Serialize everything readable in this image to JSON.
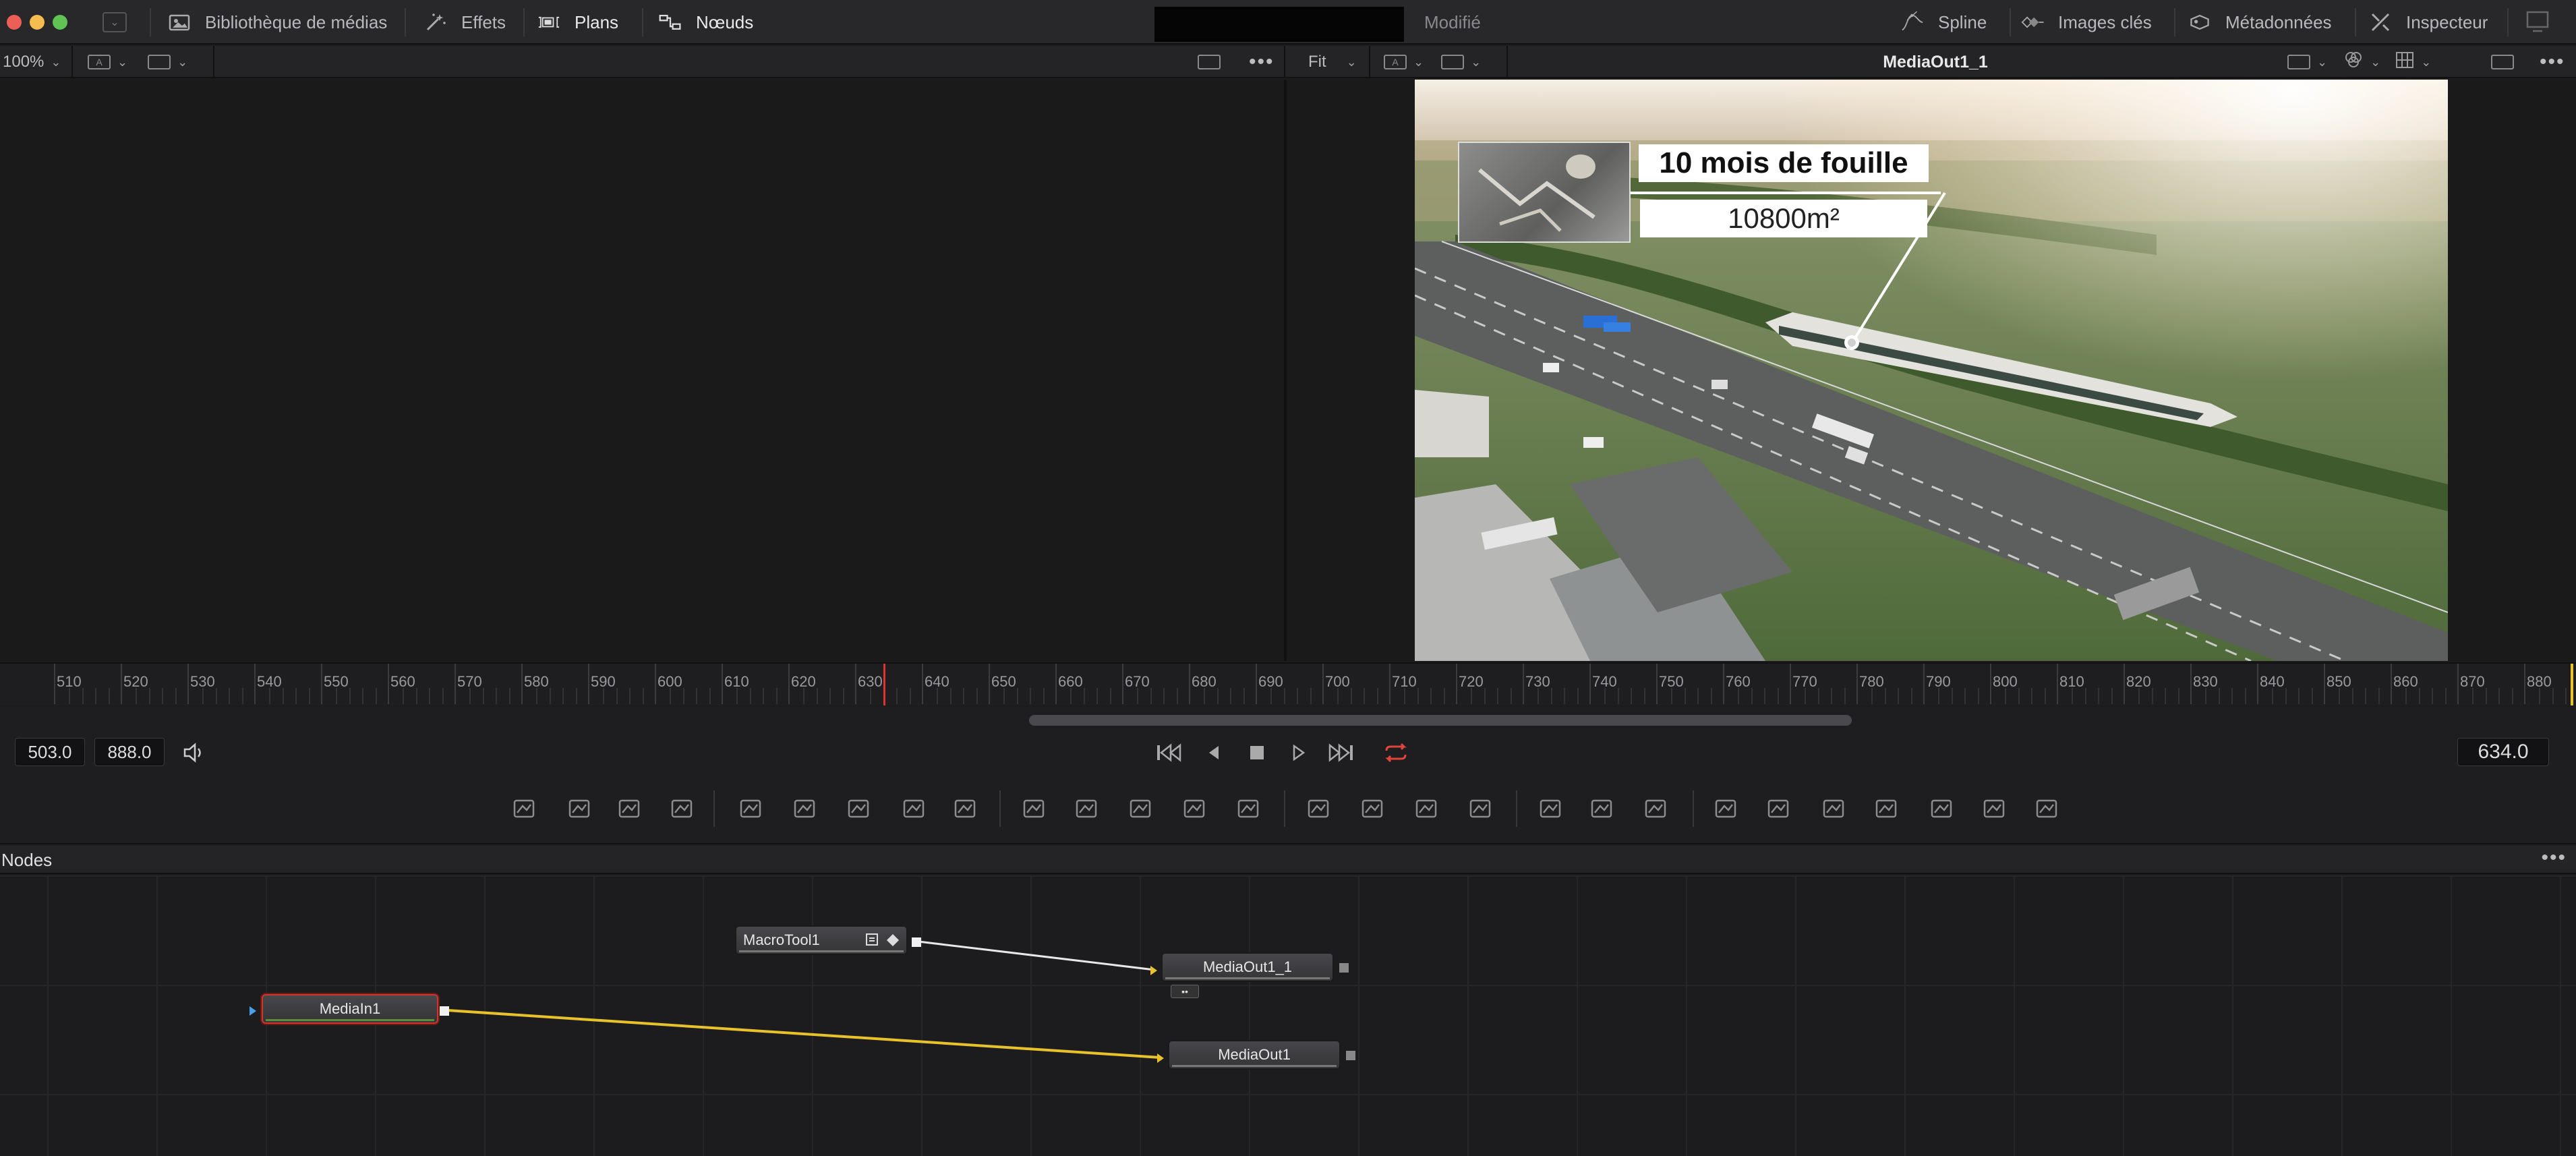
{
  "toolbar": {
    "items": [
      {
        "label": "Bibliothèque de médias",
        "icon": "media-library-icon"
      },
      {
        "label": "Effets",
        "icon": "magic-wand-icon"
      },
      {
        "label": "Plans",
        "icon": "clips-icon"
      },
      {
        "label": "Nœuds",
        "icon": "nodes-icon"
      }
    ],
    "status": "Modifié",
    "right_items": [
      {
        "label": "Spline",
        "icon": "spline-icon"
      },
      {
        "label": "Images clés",
        "icon": "keyframes-icon"
      },
      {
        "label": "Métadonnées",
        "icon": "metadata-icon"
      },
      {
        "label": "Inspecteur",
        "icon": "inspector-icon"
      }
    ]
  },
  "viewer_left": {
    "zoom": "100%"
  },
  "viewer_right": {
    "zoom": "Fit",
    "title": "MediaOut1_1"
  },
  "overlay": {
    "headline": "10 mois de fouille",
    "subline": "10800m²"
  },
  "timeline": {
    "ticks": [
      510,
      520,
      530,
      540,
      550,
      560,
      570,
      580,
      590,
      600,
      610,
      620,
      630,
      640,
      650,
      660,
      670,
      680,
      690,
      700,
      710,
      720,
      730,
      740,
      750,
      760,
      770,
      780,
      790,
      800,
      810,
      820,
      830,
      840,
      850,
      860,
      870,
      880
    ],
    "playhead_frame": 634
  },
  "transport": {
    "start": "503.0",
    "end": "888.0",
    "current": "634.0"
  },
  "nodes": {
    "title": "Nodes",
    "items": [
      {
        "label": "MacroTool1"
      },
      {
        "label": "MediaOut1_1"
      },
      {
        "label": "MediaIn1"
      },
      {
        "label": "MediaOut1"
      }
    ]
  },
  "colors": {
    "accent_yellow": "#e8c22a",
    "playhead_red": "#dd3333",
    "selected_outline": "#c8382c"
  }
}
